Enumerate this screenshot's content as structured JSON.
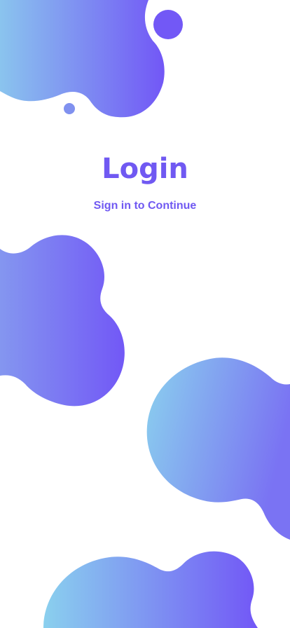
{
  "login": {
    "title": "Login",
    "subtitle": "Sign in to Continue"
  },
  "colors": {
    "accent": "#7059F2",
    "gradient_light": "#8AD0EE",
    "gradient_dark": "#7257F6",
    "background": "#FFFFFF"
  }
}
